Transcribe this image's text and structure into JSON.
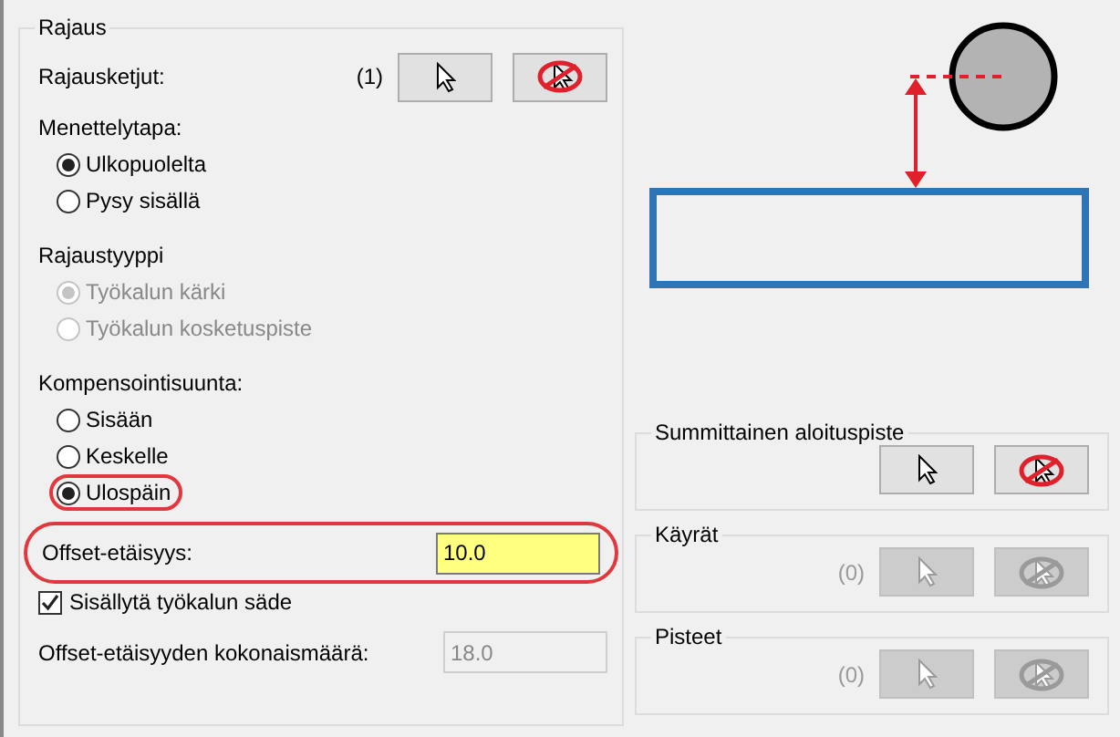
{
  "rajaus": {
    "title": "Rajaus",
    "chains": {
      "label": "Rajausketjut:",
      "count": "(1)",
      "pick_disabled": false,
      "clear_disabled": false
    },
    "method": {
      "label": "Menettelytapa:",
      "options": [
        {
          "label": "Ulkopuolelta",
          "selected": true,
          "disabled": false,
          "highlighted": false
        },
        {
          "label": "Pysy sisällä",
          "selected": false,
          "disabled": false,
          "highlighted": false
        }
      ]
    },
    "type": {
      "label": "Rajaustyyppi",
      "options": [
        {
          "label": "Työkalun kärki",
          "selected": true,
          "disabled": true,
          "highlighted": false
        },
        {
          "label": "Työkalun kosketuspiste",
          "selected": false,
          "disabled": true,
          "highlighted": false
        }
      ]
    },
    "compensation": {
      "label": "Kompensointisuunta:",
      "options": [
        {
          "label": "Sisään",
          "selected": false,
          "disabled": false,
          "highlighted": false
        },
        {
          "label": "Keskelle",
          "selected": false,
          "disabled": false,
          "highlighted": false
        },
        {
          "label": "Ulospäin",
          "selected": true,
          "disabled": false,
          "highlighted": true
        }
      ]
    },
    "offset": {
      "label": "Offset-etäisyys:",
      "value": "10.0",
      "highlighted": true
    },
    "include_radius": {
      "label": "Sisällytä työkalun säde",
      "checked": true
    },
    "total": {
      "label": "Offset-etäisyyden kokonaismäärä:",
      "value": "18.0",
      "disabled": true
    }
  },
  "groups": [
    {
      "title": "Summittainen aloituspiste",
      "disabled": false
    },
    {
      "title": "Käyrät",
      "count": "(0)",
      "disabled": true
    },
    {
      "title": "Pisteet",
      "count": "(0)",
      "disabled": true
    }
  ]
}
